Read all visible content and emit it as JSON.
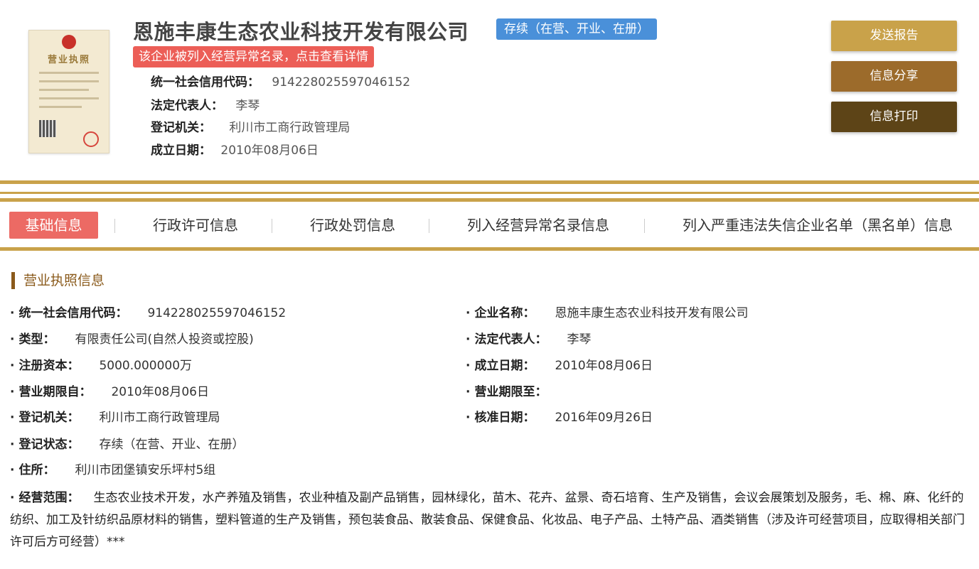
{
  "header": {
    "company_name": "恩施丰康生态农业科技开发有限公司",
    "status_badge": "存续（在营、开业、在册）",
    "abnormal_notice": "该企业被列入经营异常名录，点击查看详情",
    "license_image_title": "营业执照",
    "info": [
      {
        "label": "统一社会信用代码：",
        "value": "914228025597046152"
      },
      {
        "label": "法定代表人：",
        "value": "李琴"
      },
      {
        "label": "登记机关：",
        "value": "利川市工商行政管理局"
      },
      {
        "label": "成立日期：",
        "value": "2010年08月06日"
      }
    ]
  },
  "buttons": {
    "report": "发送报告",
    "share": "信息分享",
    "print": "信息打印"
  },
  "tabs": [
    {
      "label": "基础信息",
      "active": true
    },
    {
      "label": "行政许可信息",
      "active": false
    },
    {
      "label": "行政处罚信息",
      "active": false
    },
    {
      "label": "列入经营异常名录信息",
      "active": false
    },
    {
      "label": "列入严重违法失信企业名单（黑名单）信息",
      "active": false
    }
  ],
  "section": {
    "title": "营业执照信息",
    "bullet": "·",
    "fields": {
      "credit_code": {
        "label": "统一社会信用代码：",
        "value": "914228025597046152"
      },
      "company_name": {
        "label": "企业名称：",
        "value": "恩施丰康生态农业科技开发有限公司"
      },
      "type": {
        "label": "类型：",
        "value": "有限责任公司(自然人投资或控股)"
      },
      "legal_rep": {
        "label": "法定代表人：",
        "value": "李琴"
      },
      "capital": {
        "label": "注册资本：",
        "value": "5000.000000万"
      },
      "founded": {
        "label": "成立日期：",
        "value": "2010年08月06日"
      },
      "term_from": {
        "label": "营业期限自：",
        "value": "2010年08月06日"
      },
      "term_to": {
        "label": "营业期限至：",
        "value": ""
      },
      "authority": {
        "label": "登记机关：",
        "value": "利川市工商行政管理局"
      },
      "approval_date": {
        "label": "核准日期：",
        "value": "2016年09月26日"
      },
      "reg_status": {
        "label": "登记状态：",
        "value": "存续（在营、开业、在册）"
      },
      "address": {
        "label": "住所：",
        "value": "利川市团堡镇安乐坪村5组"
      },
      "scope": {
        "label": "经营范围：",
        "value": "生态农业技术开发，水产养殖及销售，农业种植及副产品销售，园林绿化，苗木、花卉、盆景、奇石培育、生产及销售，会议会展策划及服务，毛、棉、麻、化纤的纺织、加工及针纺织品原材料的销售，塑料管道的生产及销售，预包装食品、散装食品、保健食品、化妆品、电子产品、土特产品、酒类销售（涉及许可经营项目，应取得相关部门许可后方可经营）***"
      }
    }
  },
  "colors": {
    "gold": "#c9a24a",
    "status_blue": "#4a90d9",
    "alert_red": "#ec5e57",
    "tab_active": "#ec6a64",
    "share_brown": "#9c6b2b",
    "print_dark": "#5d4417"
  }
}
